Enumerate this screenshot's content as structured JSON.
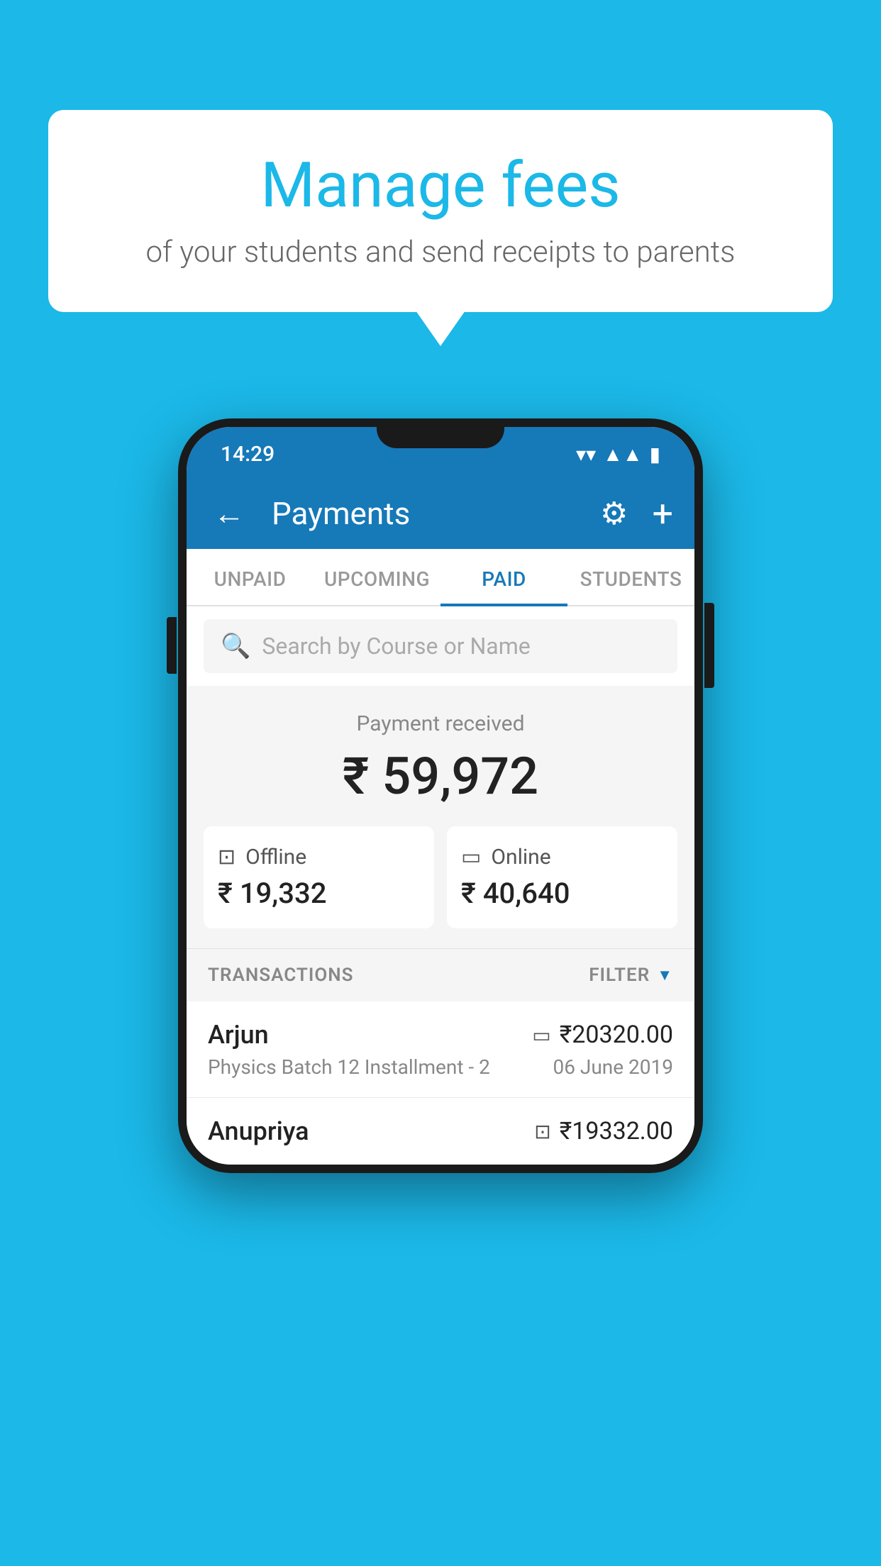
{
  "background_color": "#1bb8e8",
  "bubble": {
    "title": "Manage fees",
    "subtitle": "of your students and send receipts to parents"
  },
  "status_bar": {
    "time": "14:29",
    "icons": [
      "wifi",
      "signal",
      "battery"
    ]
  },
  "app_bar": {
    "title": "Payments",
    "back_label": "←",
    "settings_label": "⚙",
    "add_label": "+"
  },
  "tabs": [
    {
      "label": "UNPAID",
      "active": false
    },
    {
      "label": "UPCOMING",
      "active": false
    },
    {
      "label": "PAID",
      "active": true
    },
    {
      "label": "STUDENTS",
      "active": false
    }
  ],
  "search": {
    "placeholder": "Search by Course or Name"
  },
  "payment_summary": {
    "label": "Payment received",
    "total": "₹ 59,972",
    "offline_label": "Offline",
    "offline_amount": "₹ 19,332",
    "online_label": "Online",
    "online_amount": "₹ 40,640"
  },
  "transactions": {
    "header_label": "TRANSACTIONS",
    "filter_label": "FILTER",
    "rows": [
      {
        "name": "Arjun",
        "mode_icon": "card",
        "amount": "₹20320.00",
        "course": "Physics Batch 12 Installment - 2",
        "date": "06 June 2019"
      },
      {
        "name": "Anupriya",
        "mode_icon": "cash",
        "amount": "₹19332.00",
        "course": "",
        "date": ""
      }
    ]
  }
}
